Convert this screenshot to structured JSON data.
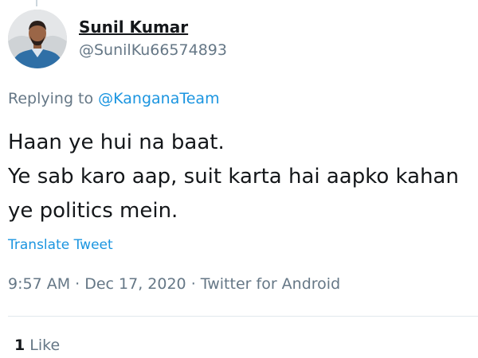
{
  "author": {
    "display_name": "Sunil Kumar",
    "handle": "@SunilKu66574893"
  },
  "reply": {
    "prefix": "Replying to ",
    "mention": "@KanganaTeam"
  },
  "tweet": {
    "lines": [
      "Haan ye hui na baat.",
      "Ye sab karo aap, suit karta hai aapko kahan",
      "ye politics mein."
    ]
  },
  "translate_label": "Translate Tweet",
  "meta": {
    "time": "9:57 AM",
    "date": "Dec 17, 2020",
    "separator": " · ",
    "source": "Twitter for Android"
  },
  "stats": {
    "like_count": "1",
    "like_label": "Like"
  },
  "colors": {
    "link": "#1b95e0",
    "muted": "#657786",
    "text": "#14171a",
    "divider": "#e1e8ed"
  }
}
